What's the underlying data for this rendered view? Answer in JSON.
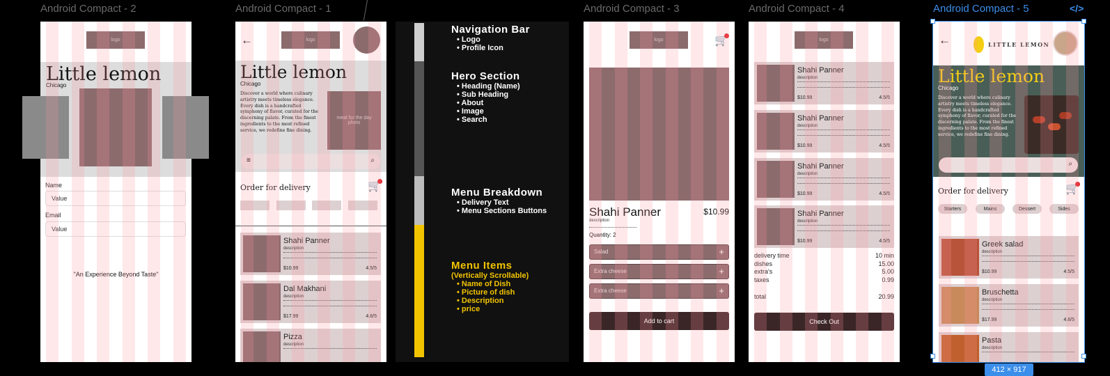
{
  "frames": {
    "f2": {
      "title": "Android Compact - 2",
      "logo": "logo",
      "heading": "Little lemon",
      "subheading": "Chicago",
      "name_label": "Name",
      "name_value": "Value",
      "email_label": "Email",
      "email_value": "Value",
      "tagline": "\"An Experience Beyond Taste\""
    },
    "f1": {
      "title": "Android Compact - 1",
      "logo": "logo",
      "heading": "Little lemon",
      "subheading": "Chicago",
      "about": "Discover a world where culinary artistry meets timeless elegance. Every dish is a handcrafted symphony of   flavor, curated for the discerning palate. From the finest ingredients to the most refined service, we redefine fine dining.",
      "hero_image": "meal for the day photo",
      "order_text": "Order for delivery",
      "items": [
        {
          "name": "Shahi Panner",
          "desc": "description",
          "price": "$10.99",
          "rating": "4.5/5"
        },
        {
          "name": "Dal Makhani",
          "desc": "description",
          "price": "$17.99",
          "rating": "4.8/5"
        },
        {
          "name": "Pizza",
          "desc": "description",
          "price": "",
          "rating": ""
        }
      ]
    },
    "notes": {
      "nav_title": "Navigation Bar",
      "nav_items": [
        "Logo",
        "Profile Icon"
      ],
      "hero_title": "Hero Section",
      "hero_items": [
        "Heading (Name)",
        "Sub Heading",
        "About",
        "Image",
        "Search"
      ],
      "menu_title": "Menu Breakdown",
      "menu_items": [
        "Delivery Text",
        "Menu Sections Buttons"
      ],
      "items_title": "Menu Items",
      "items_sub": "(Vertically Scrollable)",
      "items_list": [
        "Name of Dish",
        "Picture of dish",
        "Description",
        "price"
      ]
    },
    "f3": {
      "title": "Android Compact - 3",
      "logo": "logo",
      "dish_name": "Shahi Panner",
      "dish_price": "$10.99",
      "desc": "description",
      "quantity": "Quantity: 2",
      "options": [
        "Salad",
        "Extra cheese",
        "Extra cheese"
      ],
      "add_to_cart": "Add to cart"
    },
    "f4": {
      "title": "Android Compact - 4",
      "logo": "logo",
      "items": [
        {
          "name": "Shahi Panner",
          "desc": "description",
          "price": "$10.99",
          "rating": "4.5/5"
        },
        {
          "name": "Shahi Panner",
          "desc": "description",
          "price": "$10.99",
          "rating": "4.5/5"
        },
        {
          "name": "Shahi Panner",
          "desc": "description",
          "price": "$10.99",
          "rating": "4.5/5"
        },
        {
          "name": "Shahi Panner",
          "desc": "description",
          "price": "$10.99",
          "rating": "4.5/5"
        }
      ],
      "summary": [
        {
          "label": "delivery time",
          "value": "10 min"
        },
        {
          "label": "dishes",
          "value": "15.00"
        },
        {
          "label": "extra's",
          "value": "5.00"
        },
        {
          "label": "taxes",
          "value": "0.99"
        },
        {
          "label": "total",
          "value": "20.99"
        }
      ],
      "checkout": "Check Out"
    },
    "f5": {
      "title": "Android Compact - 5",
      "code_icon": "</>",
      "brand": "LITTLE LEMON",
      "heading": "Little lemon",
      "subheading": "Chicago",
      "about": "Discover a world where culinary artistry meets timeless elegance. Every dish is a handcrafted symphony of   flavor, curated for the discerning palate. From the finest ingredients to the most refined service, we redefine fine dining.",
      "order_text": "Order for delivery",
      "categories": [
        "Starters",
        "Mains",
        "Dessert",
        "Sides"
      ],
      "items": [
        {
          "name": "Greek salad",
          "desc": "description",
          "price": "$10.99",
          "rating": "4.5/5"
        },
        {
          "name": "Bruschetta",
          "desc": "description",
          "price": "$17.99",
          "rating": "4.8/5"
        },
        {
          "name": "Pasta",
          "desc": "description",
          "price": "",
          "rating": ""
        }
      ],
      "size_badge": "412 × 917"
    }
  },
  "colors": {
    "accent": "#3b8eea",
    "lemon": "#f4ce14",
    "hero_green": "#495e57",
    "placeholder": "#8c6b6d"
  }
}
